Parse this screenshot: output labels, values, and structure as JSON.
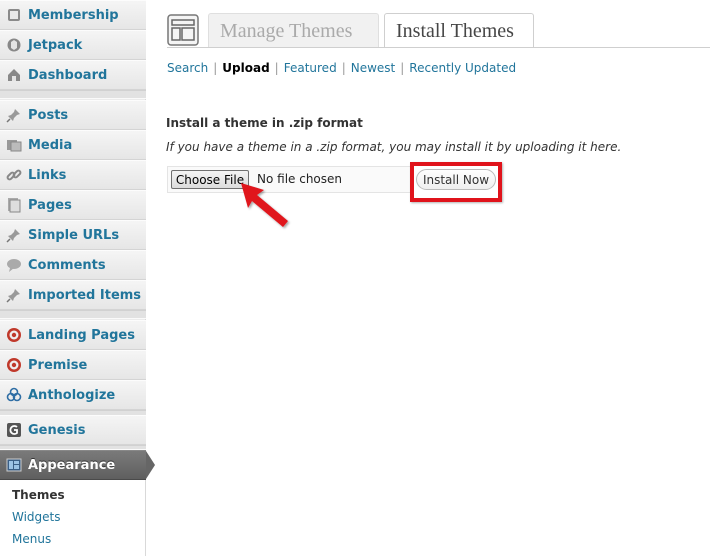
{
  "sidebar": {
    "items": [
      {
        "label": "Membership",
        "icon": "membership-icon"
      },
      {
        "label": "Jetpack",
        "icon": "jetpack-icon"
      },
      {
        "label": "Dashboard",
        "icon": "dashboard-icon"
      },
      {
        "label": "Posts",
        "icon": "pin-icon"
      },
      {
        "label": "Media",
        "icon": "media-icon"
      },
      {
        "label": "Links",
        "icon": "link-icon"
      },
      {
        "label": "Pages",
        "icon": "pages-icon"
      },
      {
        "label": "Simple URLs",
        "icon": "pin-icon"
      },
      {
        "label": "Comments",
        "icon": "comment-icon"
      },
      {
        "label": "Imported Items",
        "icon": "pin-icon"
      },
      {
        "label": "Landing Pages",
        "icon": "target-icon"
      },
      {
        "label": "Premise",
        "icon": "target-icon"
      },
      {
        "label": "Anthologize",
        "icon": "anthologize-icon"
      },
      {
        "label": "Genesis",
        "icon": "genesis-icon"
      },
      {
        "label": "Appearance",
        "icon": "appearance-icon"
      }
    ],
    "submenu": [
      {
        "label": "Themes"
      },
      {
        "label": "Widgets"
      },
      {
        "label": "Menus"
      }
    ]
  },
  "tabs": {
    "manage": "Manage Themes",
    "install": "Install Themes"
  },
  "subnav": {
    "search": "Search",
    "upload": "Upload",
    "featured": "Featured",
    "newest": "Newest",
    "recent": "Recently Updated",
    "sep": "|"
  },
  "upload": {
    "title": "Install a theme in .zip format",
    "description": "If you have a theme in a .zip format, you may install it by uploading it here.",
    "choose_label": "Choose File",
    "no_file": "No file chosen",
    "install_label": "Install Now"
  },
  "colors": {
    "link": "#21759b",
    "highlight": "#e0131b"
  }
}
